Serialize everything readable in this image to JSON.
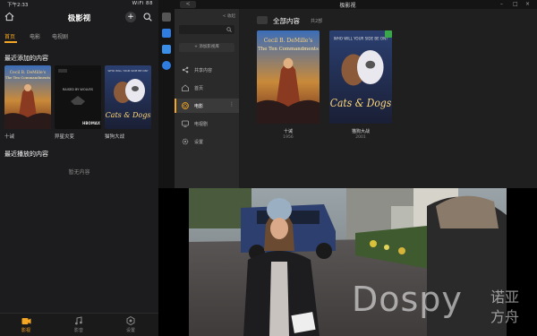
{
  "phone": {
    "status": {
      "time": "下午2:33",
      "right": "WiFi 88"
    },
    "app_title": "极影视",
    "tabs": [
      {
        "label": "首页",
        "active": true
      },
      {
        "label": "电影",
        "active": false
      },
      {
        "label": "电视剧",
        "active": false
      }
    ],
    "recent_added_title": "最近添加的内容",
    "recent_items": [
      {
        "title": "十诫",
        "poster": "ten-commandments"
      },
      {
        "title": "异星灾变",
        "poster": "raised-by-wolves"
      },
      {
        "title": "猫狗大战",
        "poster": "cats-and-dogs"
      }
    ],
    "recent_played_title": "最近播放的内容",
    "empty_text": "暂无内容",
    "bottom_nav": [
      {
        "label": "影视",
        "icon": "film-icon",
        "active": true
      },
      {
        "label": "影音",
        "icon": "music-icon",
        "active": false
      },
      {
        "label": "设置",
        "icon": "gear-icon",
        "active": false
      }
    ]
  },
  "desktop": {
    "window_title": "极影视",
    "back_label": "<",
    "collapse_label": "< 收起",
    "add_library_label": "+ 添加影视库",
    "sidebar_items": [
      {
        "label": "共享内容",
        "icon": "share-icon",
        "active": false
      },
      {
        "label": "首页",
        "icon": "home-icon",
        "active": false
      },
      {
        "label": "电影",
        "icon": "film-icon",
        "active": true
      },
      {
        "label": "电视剧",
        "icon": "tv-icon",
        "active": false
      },
      {
        "label": "设置",
        "icon": "gear-icon",
        "active": false
      }
    ],
    "main_title": "全部内容",
    "main_count": "共2部",
    "items": [
      {
        "title": "十诫",
        "year": "1956",
        "poster": "ten-commandments"
      },
      {
        "title": "猫狗大战",
        "year": "2001",
        "poster": "cats-and-dogs"
      }
    ]
  },
  "watermark": {
    "brand": "Dospy",
    "cn_line1": "诺亚",
    "cn_line2": "方舟"
  },
  "colors": {
    "accent": "#f5a623",
    "bg_dark": "#1c1c1e",
    "blue_rail": "#2f7de1"
  }
}
